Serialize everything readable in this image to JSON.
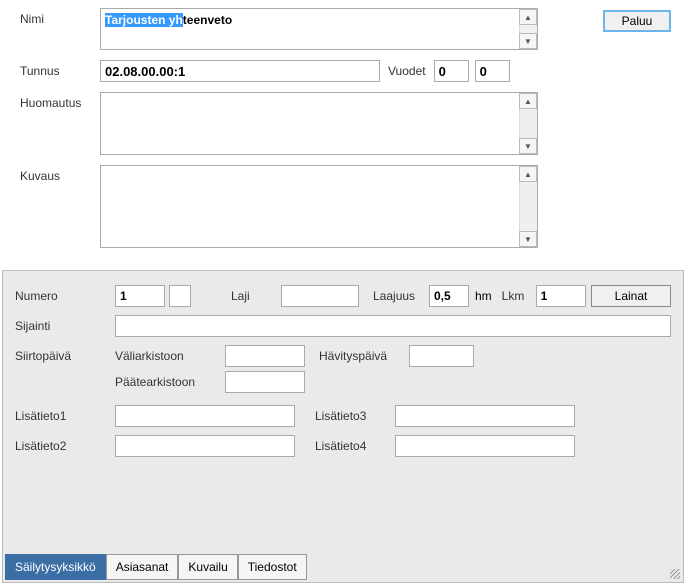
{
  "header": {
    "paluu_label": "Paluu"
  },
  "top": {
    "nimi_label": "Nimi",
    "nimi_value": "Tarjousten yhteenveto",
    "nimi_selected_part": "Tarjousten yh",
    "nimi_rest_part": "teenveto",
    "tunnus_label": "Tunnus",
    "tunnus_value": "02.08.00.00:1",
    "vuodet_label": "Vuodet",
    "vuodet_from": "0",
    "vuodet_to": "0",
    "huomautus_label": "Huomautus",
    "huomautus_value": "",
    "kuvaus_label": "Kuvaus",
    "kuvaus_value": ""
  },
  "bottom": {
    "numero_label": "Numero",
    "numero_value": "1",
    "laji_label": "Laji",
    "laji_value": "",
    "laajuus_label": "Laajuus",
    "laajuus_value": "0,5",
    "laajuus_unit": "hm",
    "lkm_label": "Lkm",
    "lkm_value": "1",
    "lainat_label": "Lainat",
    "sijainti_label": "Sijainti",
    "sijainti_value": "",
    "siirtopaiva_label": "Siirtopäivä",
    "valiarkistoon_label": "Väliarkistoon",
    "valiarkistoon_value": "",
    "havityspaiva_label": "Hävityspäivä",
    "havityspaiva_value": "",
    "paatearkistoon_label": "Päätearkistoon",
    "paatearkistoon_value": "",
    "lisatieto1_label": "Lisätieto1",
    "lisatieto1_value": "",
    "lisatieto2_label": "Lisätieto2",
    "lisatieto2_value": "",
    "lisatieto3_label": "Lisätieto3",
    "lisatieto3_value": "",
    "lisatieto4_label": "Lisätieto4",
    "lisatieto4_value": ""
  },
  "tabs": {
    "t1": "Säilytysyksikkö",
    "t2": "Asiasanat",
    "t3": "Kuvailu",
    "t4": "Tiedostot"
  }
}
